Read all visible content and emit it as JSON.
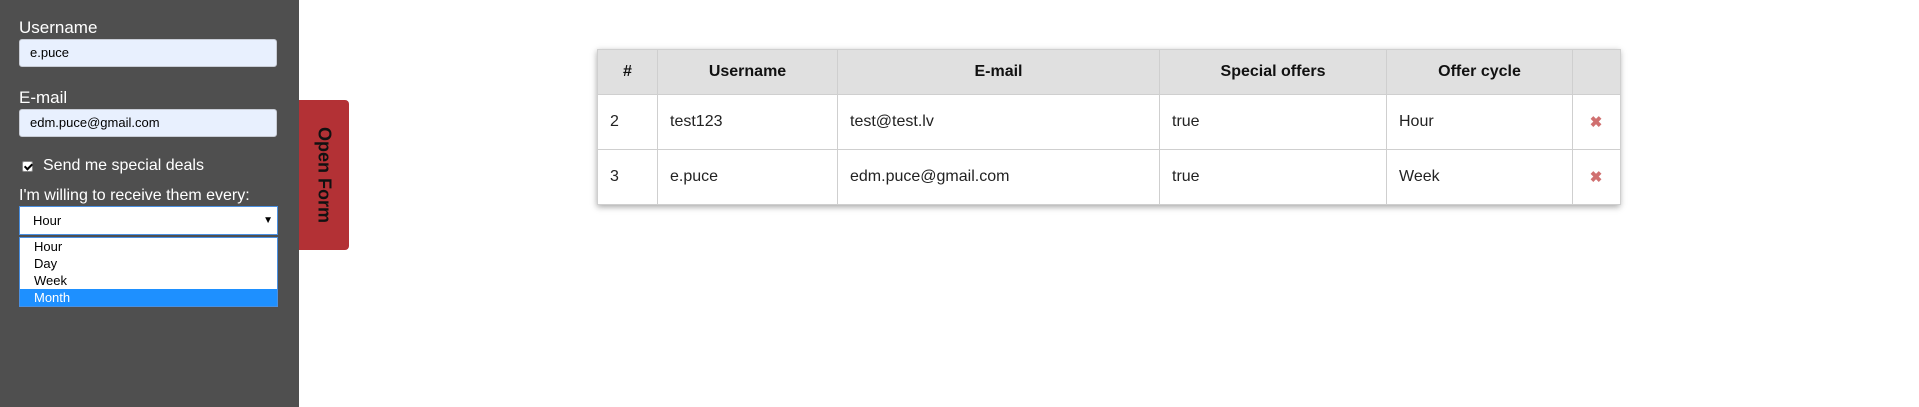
{
  "form": {
    "username_label": "Username",
    "username_value": "e.puce",
    "email_label": "E-mail",
    "email_value": "edm.puce@gmail.com",
    "deals_label": "Send me special deals",
    "deals_checked": true,
    "cycle_label": "I'm willing to receive them every:",
    "cycle_selected": "Hour",
    "cycle_options": [
      "Hour",
      "Day",
      "Week",
      "Month"
    ],
    "highlighted_option": "Month"
  },
  "open_form_label": "Open Form",
  "table": {
    "headers": [
      "#",
      "Username",
      "E-mail",
      "Special offers",
      "Offer cycle",
      ""
    ],
    "rows": [
      {
        "id": "2",
        "username": "test123",
        "email": "test@test.lv",
        "special_offers": "true",
        "offer_cycle": "Hour",
        "delete": "✖"
      },
      {
        "id": "3",
        "username": "e.puce",
        "email": "edm.puce@gmail.com",
        "special_offers": "true",
        "offer_cycle": "Week",
        "delete": "✖"
      }
    ]
  },
  "colors": {
    "sidebar": "#4f4f4f",
    "open_tab": "#b33135",
    "highlight": "#1e90ff",
    "delete_icon": "#d07070"
  },
  "icons": {
    "delete": "close-icon",
    "select_arrow": "chevron-down-icon"
  }
}
